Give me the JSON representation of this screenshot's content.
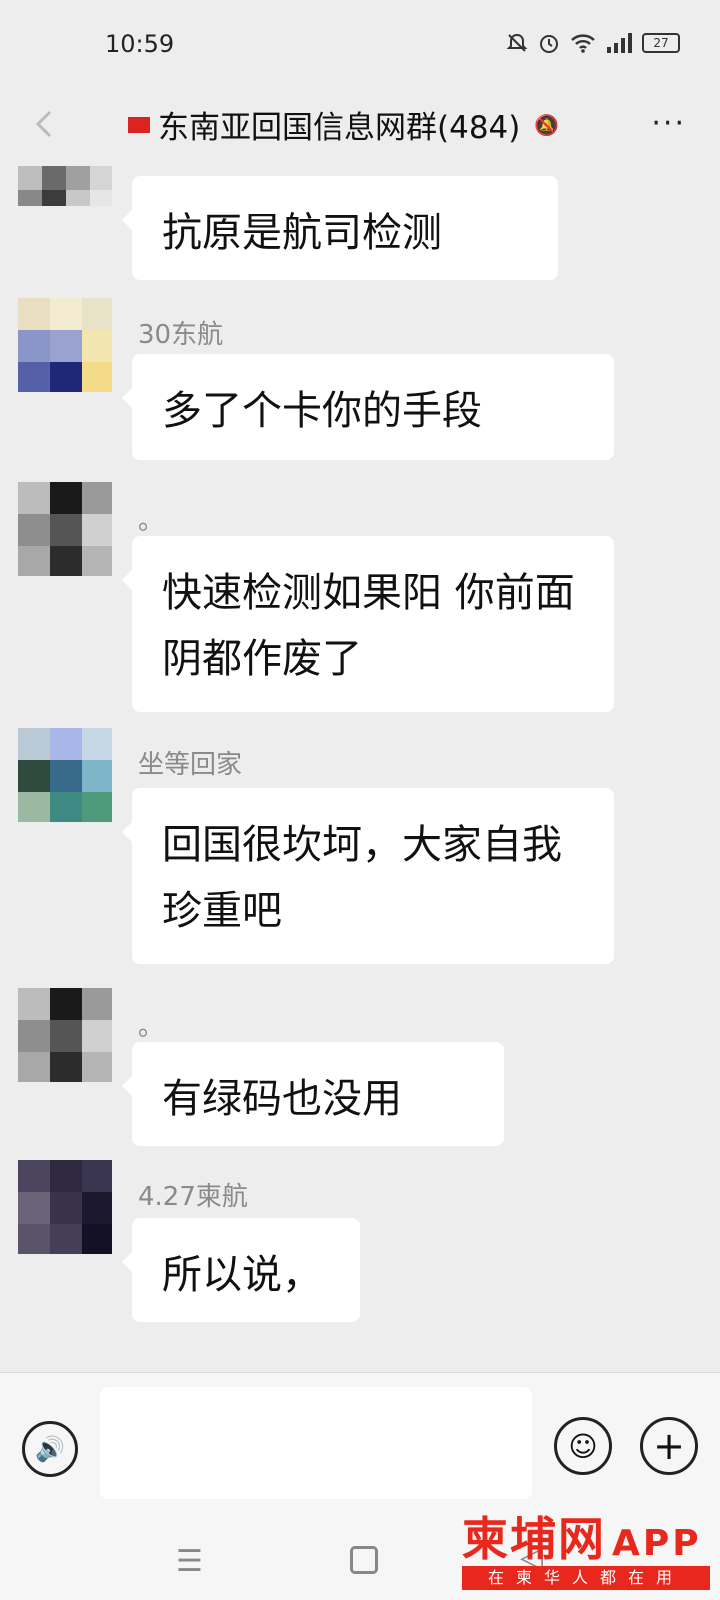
{
  "status_bar": {
    "time": "10:59",
    "battery": "27"
  },
  "header": {
    "title": "东南亚回国信息网群(484)",
    "more": "···"
  },
  "messages": [
    {
      "sender": "",
      "text": "抗原是航司检测"
    },
    {
      "sender": "30东航",
      "text": "多了个卡你的手段"
    },
    {
      "sender": "。",
      "text": "快速检测如果阳 你前面阴都作废了"
    },
    {
      "sender": "坐等回家",
      "text": "回国很坎坷，大家自我珍重吧"
    },
    {
      "sender": "。",
      "text": "有绿码也没用"
    },
    {
      "sender": "4.27柬航",
      "text": "所以说，"
    }
  ],
  "input_bar": {
    "placeholder": ""
  },
  "watermark": {
    "main": "柬埔网",
    "app": "APP",
    "sub": "在柬华人都在用"
  }
}
